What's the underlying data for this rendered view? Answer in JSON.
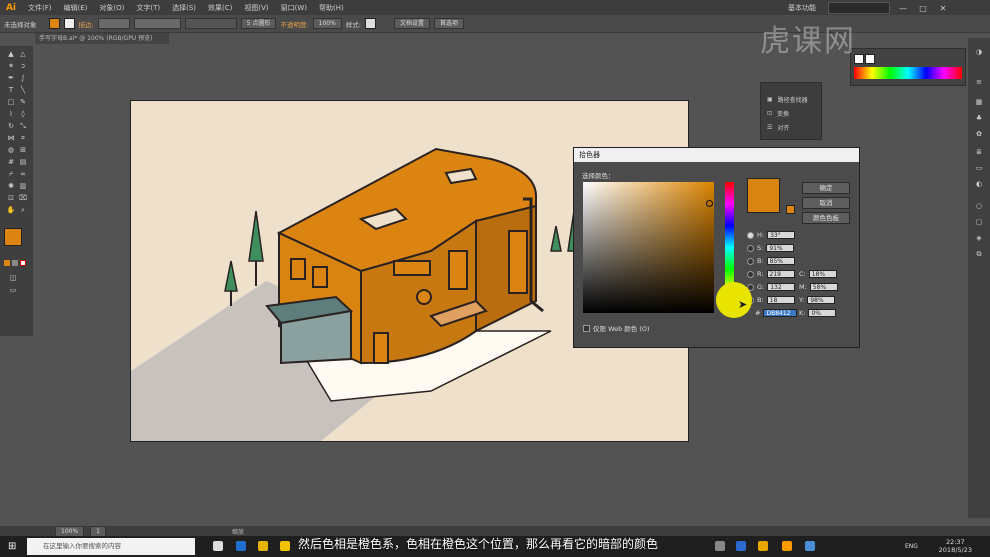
{
  "app": {
    "logo": "Ai"
  },
  "menu": [
    "文件(F)",
    "编辑(E)",
    "对象(O)",
    "文字(T)",
    "选择(S)",
    "效果(C)",
    "视图(V)",
    "窗口(W)",
    "帮助(H)"
  ],
  "workspace": "基本功能",
  "window_buttons": [
    "—",
    "□",
    "✕"
  ],
  "control_bar": {
    "selection": "未选择对象",
    "stroke_label": "描边:",
    "brush": "5 点圆形",
    "opacity_label": "不透明度:",
    "opacity_value": "100%",
    "style_label": "样式:",
    "doc_setup": "文档设置",
    "preferences": "首选项"
  },
  "doc_tab": "手写字母B.ai* @ 100% (RGB/GPU 预览)",
  "small_panel": {
    "items": [
      "路径查找器",
      "变换",
      "对齐"
    ]
  },
  "color_picker": {
    "title": "拾色器",
    "subtitle": "选择颜色：",
    "buttons": {
      "ok": "确定",
      "cancel": "取消",
      "swatches": "颜色色板"
    },
    "hsb": [
      {
        "label": "H:",
        "value": "33°"
      },
      {
        "label": "S:",
        "value": "91%"
      },
      {
        "label": "B:",
        "value": "85%"
      }
    ],
    "rgb": [
      {
        "label": "R:",
        "value": "219"
      },
      {
        "label": "G:",
        "value": "132"
      },
      {
        "label": "B:",
        "value": "18"
      }
    ],
    "cmyk": [
      {
        "label": "C:",
        "value": "18%"
      },
      {
        "label": "M:",
        "value": "58%"
      },
      {
        "label": "Y:",
        "value": "98%"
      },
      {
        "label": "K:",
        "value": "0%"
      }
    ],
    "hex_label": "#",
    "hex": "DB8412",
    "web_only": "仅限 Web 颜色 (O)"
  },
  "status_bar": {
    "zoom": "100%",
    "page": "1",
    "tool": "缩放"
  },
  "taskbar": {
    "search_placeholder": "在这里输入你要搜索的内容",
    "time": "22:37",
    "date": "2018/5/23",
    "lang": "ENG"
  },
  "subtitle": "然后色相是橙色系，色相在橙色这个位置，那么再看它的暗部的颜色",
  "watermark": "虎课网",
  "colors": {
    "accent": "#DB8412",
    "building": "#D98411",
    "awning": "#5E7E7C",
    "background": "#EFE0CC"
  }
}
